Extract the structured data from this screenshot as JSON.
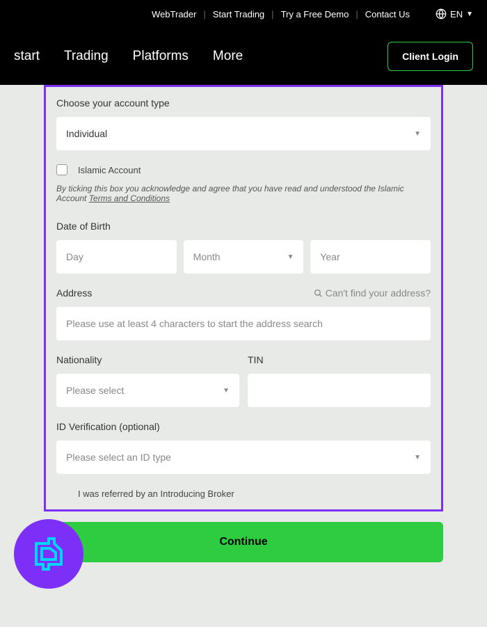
{
  "topbar": {
    "links": [
      "WebTrader",
      "Start Trading",
      "Try a Free Demo",
      "Contact Us"
    ],
    "language": "EN"
  },
  "nav": {
    "items": [
      "start",
      "Trading",
      "Platforms",
      "More"
    ],
    "client_login": "Client Login"
  },
  "form": {
    "account_type_label": "Choose your account type",
    "account_type_value": "Individual",
    "islamic_label": "Islamic Account",
    "islamic_disclaimer_prefix": "By ticking this box you acknowledge and agree that you have read and understood the Islamic Account ",
    "islamic_disclaimer_link": "Terms and Conditions",
    "dob_label": "Date of Birth",
    "dob_day": "Day",
    "dob_month": "Month",
    "dob_year": "Year",
    "address_label": "Address",
    "address_hint": "Can't find your address?",
    "address_placeholder": "Please use at least 4 characters to start the address search",
    "nationality_label": "Nationality",
    "nationality_placeholder": "Please select",
    "tin_label": "TIN",
    "id_verification_label": "ID Verification (optional)",
    "id_verification_placeholder": "Please select an ID type",
    "referral_label": "I was referred by an Introducing Broker",
    "continue": "Continue"
  }
}
